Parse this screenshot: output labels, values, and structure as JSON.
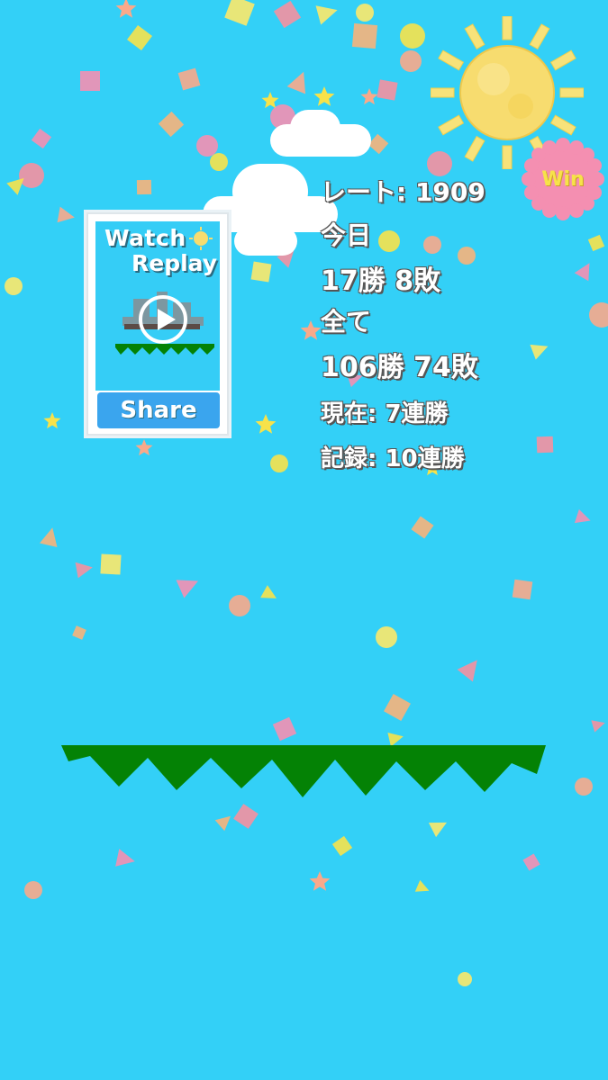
{
  "badge": {
    "win_label": "Win"
  },
  "replay": {
    "watch_label": "Watch",
    "replay_label": "Replay",
    "share_label": "Share"
  },
  "stats": {
    "rate": "レート: 1909",
    "today_heading": "今日",
    "today_record": "17勝 8敗",
    "all_heading": "全て",
    "all_record": "106勝 74敗",
    "current_streak": "現在: 7連勝",
    "best_streak": "記録: 10連勝"
  },
  "colors": {
    "sky": "#33d0f7",
    "ground": "#048205",
    "stat_text": "#ffffff",
    "share_button": "#3aa5ee",
    "win_badge": "#f48fb1",
    "win_text": "#f7e24a",
    "sun": "#f7dc6f"
  },
  "icons": [
    "sun-icon",
    "play-icon",
    "win-badge-icon"
  ]
}
